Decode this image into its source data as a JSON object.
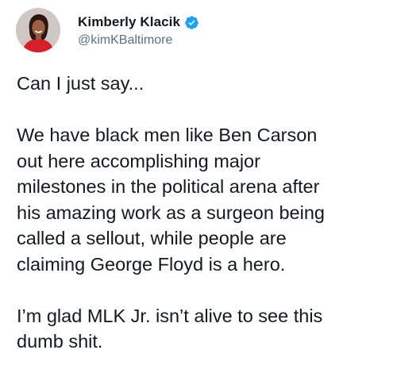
{
  "author": {
    "display_name": "Kimberly Klacik",
    "handle": "@kimKBaltimore",
    "verified": true,
    "avatar_icon": "profile-photo",
    "verified_icon": "verified-badge-icon",
    "verified_color": "#1da1f2"
  },
  "tweet": {
    "paragraphs": [
      {
        "lines": [
          "Can I just say..."
        ]
      },
      {
        "lines": [
          "We have black men like Ben Carson",
          "out here accomplishing major",
          "milestones in the political arena after",
          "his amazing work as a surgeon being",
          "called a sellout, while people are",
          "claiming George Floyd is a hero."
        ]
      },
      {
        "lines": [
          "I’m glad MLK Jr. isn’t alive to see this",
          "dumb shit."
        ]
      }
    ]
  }
}
